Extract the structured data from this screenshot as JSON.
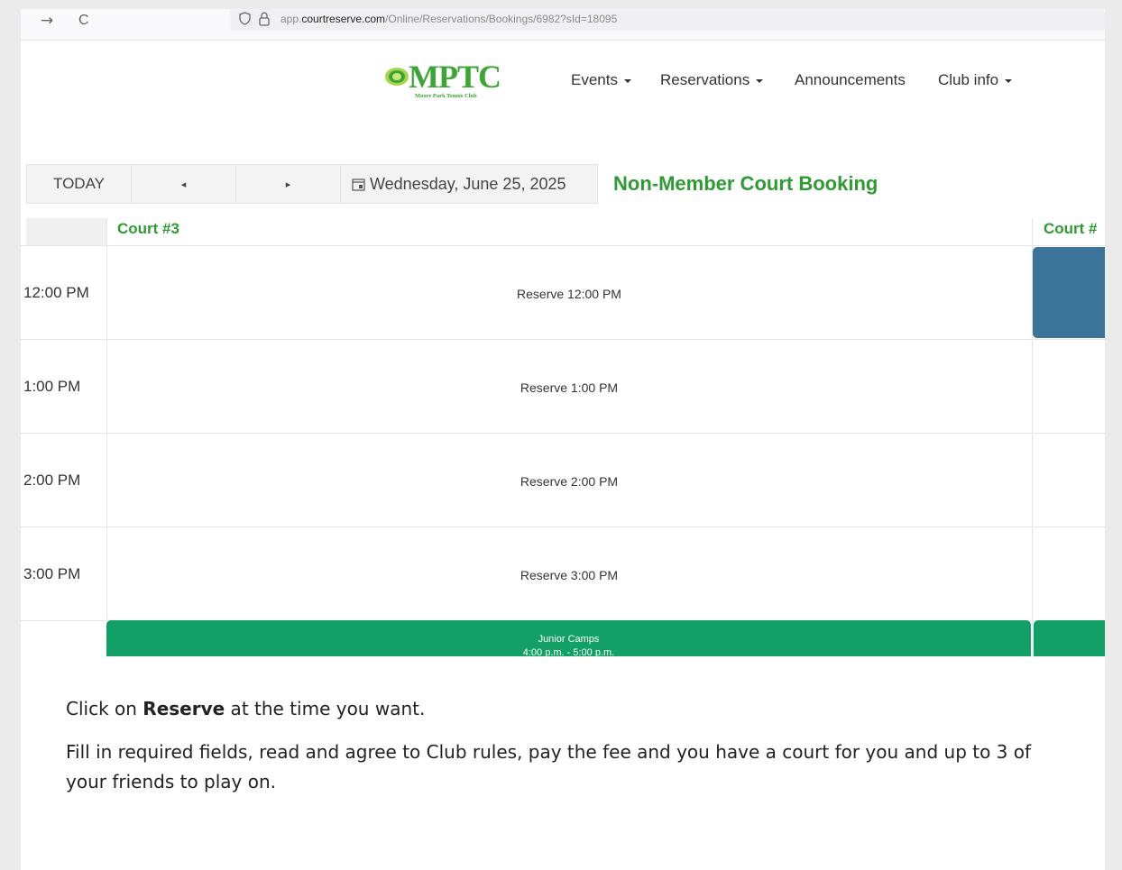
{
  "browser": {
    "back_glyph": "→",
    "reload_glyph": "C",
    "url_prefix": "app.",
    "url_domain": "courtreserve.com",
    "url_path": "/Online/Reservations/Bookings/6982?sId=18095"
  },
  "logo": {
    "text": "MPTC",
    "subtitle": "Moore Park Tennis Club",
    "color": "#3ca534"
  },
  "nav": {
    "events": "Events",
    "reservations": "Reservations",
    "announcements": "Announcements",
    "club_info": "Club info"
  },
  "toolbar": {
    "today": "TODAY",
    "prev": "◂",
    "next": "▸",
    "date": "Wednesday, June 25, 2025",
    "title": "Non-Member Court Booking"
  },
  "scheduler": {
    "courts": [
      "Court #3",
      "Court #"
    ],
    "slots": [
      {
        "time": "12:00 PM",
        "reserve": "Reserve 12:00 PM"
      },
      {
        "time": "1:00 PM",
        "reserve": "Reserve 1:00 PM"
      },
      {
        "time": "2:00 PM",
        "reserve": "Reserve 2:00 PM"
      },
      {
        "time": "3:00 PM",
        "reserve": "Reserve 3:00 PM"
      }
    ],
    "event": {
      "title": "Junior Camps",
      "time": "4:00 p.m. - 5:00 p.m."
    },
    "colors": {
      "accent": "#2d9b32",
      "booked": "#3b7399",
      "event": "#13a066"
    }
  },
  "instructions": {
    "line1_pre": "Click on ",
    "line1_bold": "Reserve",
    "line1_post": " at the time you want.",
    "line2": "Fill in required fields, read and agree to Club rules, pay the fee and you have a court for you and up to 3 of your friends to play on."
  }
}
